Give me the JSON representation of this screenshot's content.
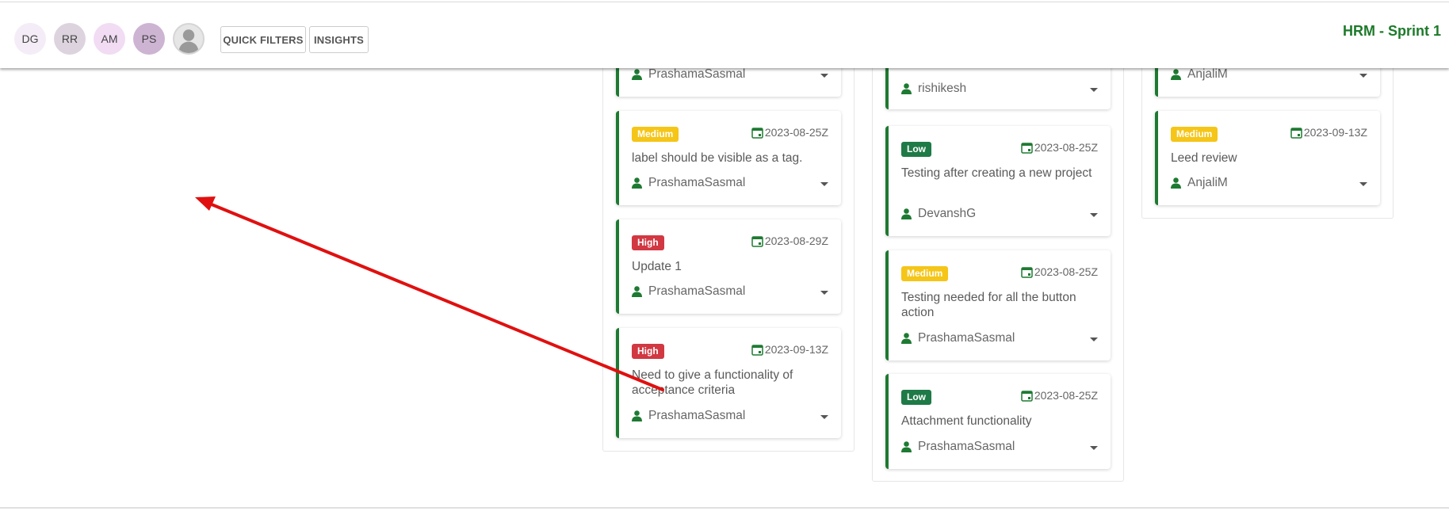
{
  "header": {
    "avatars": [
      "DG",
      "RR",
      "AM",
      "PS"
    ],
    "quick_filters_label": "QUICK FILTERS",
    "insights_label": "INSIGHTS",
    "project_title": "HRM - Sprint 1"
  },
  "colors": {
    "accent_green": "#1e7a32",
    "priority_medium": "#f5c518",
    "priority_high": "#d13842",
    "priority_low": "#1e7a47",
    "annotation_arrow": "#e01010"
  },
  "column1": {
    "partial_card": {
      "assignee": "PrashamaSasmal"
    },
    "cards": [
      {
        "priority": "Medium",
        "date": "2023-08-25Z",
        "title": "label should be visible as a tag.",
        "assignee": "PrashamaSasmal"
      },
      {
        "priority": "High",
        "date": "2023-08-29Z",
        "title": "Update 1",
        "assignee": "PrashamaSasmal"
      },
      {
        "priority": "High",
        "date": "2023-09-13Z",
        "title": "Need to give a functionality of acceptance criteria",
        "assignee": "PrashamaSasmal"
      }
    ]
  },
  "column2": {
    "partial_card": {
      "assignee": "rishikesh"
    },
    "cards": [
      {
        "priority": "Low",
        "date": "2023-08-25Z",
        "title": "Testing after creating a new project",
        "assignee": "DevanshG"
      },
      {
        "priority": "Medium",
        "date": "2023-08-25Z",
        "title": "Testing needed for all the button action",
        "assignee": "PrashamaSasmal"
      },
      {
        "priority": "Low",
        "date": "2023-08-25Z",
        "title": "Attachment functionality",
        "assignee": "PrashamaSasmal"
      }
    ]
  },
  "column3": {
    "partial_card": {
      "assignee": "AnjaliM"
    },
    "cards": [
      {
        "priority": "Medium",
        "date": "2023-09-13Z",
        "title": "Leed review",
        "assignee": "AnjaliM"
      }
    ]
  }
}
